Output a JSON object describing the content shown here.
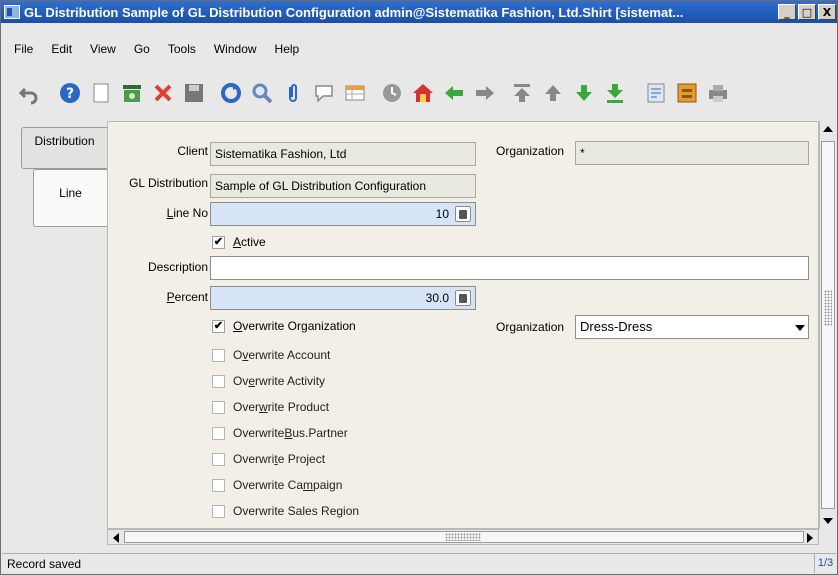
{
  "window": {
    "title": "GL Distribution  Sample of GL Distribution Configuration  admin@Sistematika Fashion, Ltd.Shirt [sistemat...",
    "minimize_glyph": "_",
    "maximize_glyph": "□",
    "close_glyph": "X"
  },
  "menu": [
    "File",
    "Edit",
    "View",
    "Go",
    "Tools",
    "Window",
    "Help"
  ],
  "toolbar": {
    "icons": [
      "undo-icon",
      "help-icon",
      "new-icon",
      "copy-icon",
      "delete-icon",
      "save-icon",
      "refresh-icon",
      "find-icon",
      "attachment-icon",
      "chat-icon",
      "grid-toggle-icon",
      "history-icon",
      "home-icon",
      "parent-record-icon",
      "detail-record-icon",
      "first-record-icon",
      "previous-record-icon",
      "next-record-icon",
      "last-record-icon",
      "report-icon",
      "archive-icon",
      "print-icon"
    ]
  },
  "tabs": [
    {
      "label": "Distribution",
      "active": false
    },
    {
      "label": "Line",
      "active": true
    }
  ],
  "form": {
    "client_label": "Client",
    "client_value": "Sistematika Fashion, Ltd",
    "organization_label": "Organization",
    "organization_value": "*",
    "gl_distribution_label": "GL Distribution",
    "gl_distribution_value": "Sample of GL Distribution Configuration",
    "line_no_label_pre": "",
    "line_no_label_u": "L",
    "line_no_label_post": "ine No",
    "line_no_value": "10",
    "active_label_u": "A",
    "active_label_post": "ctive",
    "active_checked": true,
    "description_label": "Description",
    "description_value": "",
    "percent_label_u": "P",
    "percent_label_post": "ercent",
    "percent_value": "30.0",
    "overwrite_org_label_u": "O",
    "overwrite_org_label_post": "verwrite Organization",
    "overwrite_org_checked": true,
    "org_select_label_pre": "Or",
    "org_select_label_u": "g",
    "org_select_label_post": "anization",
    "org_select_value": "Dress-Dress",
    "checkboxes": [
      {
        "pre": "O",
        "u": "v",
        "post": "erwrite Account",
        "checked": false
      },
      {
        "pre": "Ov",
        "u": "e",
        "post": "rwrite Activity",
        "checked": false
      },
      {
        "pre": "Over",
        "u": "w",
        "post": "rite Product",
        "checked": false
      },
      {
        "pre": "Overwrite ",
        "u": "B",
        "post": "us.Partner",
        "checked": false
      },
      {
        "pre": "Overwri",
        "u": "t",
        "post": "e Project",
        "checked": false
      },
      {
        "pre": "Overwrite Ca",
        "u": "m",
        "post": "paign",
        "checked": false
      },
      {
        "pre": "Overwrite Sales Region",
        "u": "",
        "post": "",
        "checked": false
      }
    ]
  },
  "status": {
    "message": "Record saved",
    "record_count": "1/3"
  }
}
